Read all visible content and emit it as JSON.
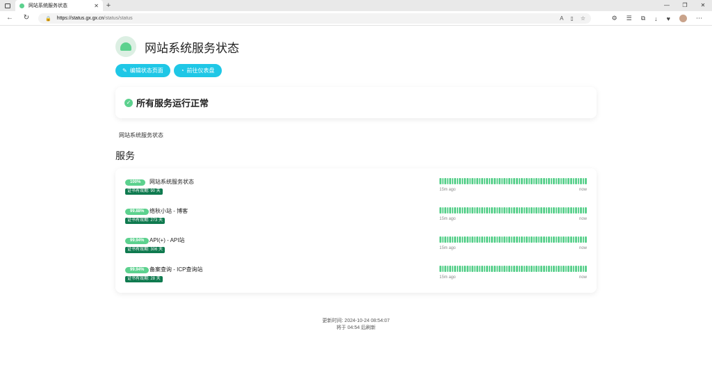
{
  "browser": {
    "tab_title": "网站系统服务状态",
    "url_host": "https://status.gx.gx.cn",
    "url_path": "/status/status"
  },
  "page": {
    "title": "网站系统服务状态",
    "buttons": {
      "edit": "编辑状态页面",
      "dashboard": "前往仪表盘"
    },
    "overall_status": "所有服务运行正常",
    "description": "网站系统服务状态",
    "section_title": "服务"
  },
  "services": [
    {
      "uptime": "100%",
      "name": "网站系统服务状态",
      "cert": "证书有效期: 90 天",
      "ago": "15m ago",
      "now": "now"
    },
    {
      "uptime": "99.88%",
      "name": "络秋小站 - 博客",
      "cert": "证书有效期: 273 天",
      "ago": "15m ago",
      "now": "now"
    },
    {
      "uptime": "99.94%",
      "name": "API(+) - API站",
      "cert": "证书有效期: 306 天",
      "ago": "15m ago",
      "now": "now"
    },
    {
      "uptime": "99.94%",
      "name": "备案查询 - ICP查询站",
      "cert": "证书有效期: 28 天",
      "ago": "15m ago",
      "now": "now"
    }
  ],
  "footer": {
    "updated": "更新时间: 2024-10-24 08:54:07",
    "refresh": "将于 04:54 后刷新"
  },
  "colors": {
    "accent": "#1fc7e6",
    "up": "#5cd18e",
    "cert": "#0f7a4f"
  }
}
